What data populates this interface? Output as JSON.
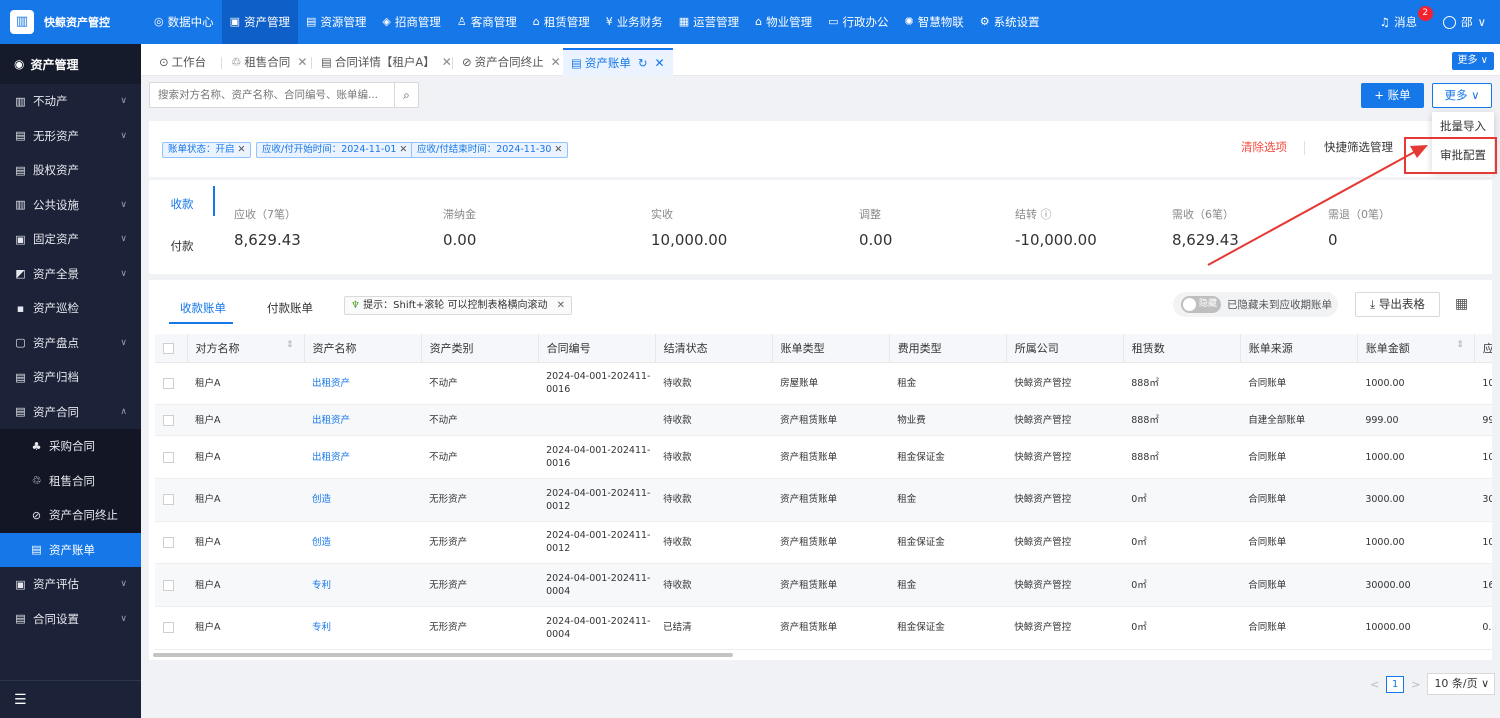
{
  "brand": "快鲸资产管控",
  "nav": [
    {
      "icon": "◎",
      "label": "数据中心"
    },
    {
      "icon": "▣",
      "label": "资产管理"
    },
    {
      "icon": "▤",
      "label": "资源管理"
    },
    {
      "icon": "◈",
      "label": "招商管理"
    },
    {
      "icon": "♙",
      "label": "客商管理"
    },
    {
      "icon": "⌂",
      "label": "租赁管理"
    },
    {
      "icon": "¥",
      "label": "业务财务"
    },
    {
      "icon": "▦",
      "label": "运营管理"
    },
    {
      "icon": "⌂",
      "label": "物业管理"
    },
    {
      "icon": "▭",
      "label": "行政办公"
    },
    {
      "icon": "✺",
      "label": "智慧物联"
    },
    {
      "icon": "⚙",
      "label": "系统设置"
    }
  ],
  "header": {
    "messages_label": "消息",
    "messages_count": "2",
    "user_name": "邵"
  },
  "sidebar": {
    "title": "资产管理",
    "items": [
      {
        "icon": "▥",
        "label": "不动产",
        "chevron": "∨"
      },
      {
        "icon": "▤",
        "label": "无形资产",
        "chevron": "∨"
      },
      {
        "icon": "▤",
        "label": "股权资产",
        "chevron": ""
      },
      {
        "icon": "▥",
        "label": "公共设施",
        "chevron": "∨"
      },
      {
        "icon": "▣",
        "label": "固定资产",
        "chevron": "∨"
      },
      {
        "icon": "◩",
        "label": "资产全景",
        "chevron": "∨"
      },
      {
        "icon": "▪",
        "label": "资产巡检",
        "chevron": ""
      },
      {
        "icon": "▢",
        "label": "资产盘点",
        "chevron": "∨"
      },
      {
        "icon": "▤",
        "label": "资产归档",
        "chevron": ""
      },
      {
        "icon": "▤",
        "label": "资产合同",
        "chevron": "∧"
      }
    ],
    "sub_items": [
      {
        "icon": "♣",
        "label": "采购合同"
      },
      {
        "icon": "♲",
        "label": "租售合同"
      },
      {
        "icon": "⊘",
        "label": "资产合同终止"
      },
      {
        "icon": "▤",
        "label": "资产账单"
      }
    ],
    "after_items": [
      {
        "icon": "▣",
        "label": "资产评估",
        "chevron": "∨"
      },
      {
        "icon": "▤",
        "label": "合同设置",
        "chevron": "∨"
      }
    ],
    "footer_icon": "☰"
  },
  "tabs": [
    {
      "icon": "⊙",
      "label": "工作台",
      "close": ""
    },
    {
      "icon": "♲",
      "label": "租售合同",
      "close": "✕"
    },
    {
      "icon": "▤",
      "label": "合同详情【租户A】",
      "close": "✕"
    },
    {
      "icon": "⊘",
      "label": "资产合同终止",
      "close": "✕"
    },
    {
      "icon": "▤",
      "label": "资产账单",
      "close": "✕"
    }
  ],
  "tabs_more": "更多 ∨",
  "search": {
    "placeholder": "搜索对方名称、资产名称、合同编号、账单编..."
  },
  "actions": {
    "add_label": "+ 账单",
    "more_label": "更多 ∨"
  },
  "dropdown": {
    "items": [
      "批量导入",
      "审批配置"
    ]
  },
  "filters": {
    "chips": [
      "账单状态：开启",
      "应收/付开始时间：2024-11-01",
      "应收/付结束时间：2024-11-30"
    ],
    "clear_label": "清除选项",
    "quick_label": "快捷筛选管理"
  },
  "stats": {
    "tabs": [
      "收款",
      "付款"
    ],
    "items": [
      {
        "label": "应收（7笔）",
        "value": "8,629.43"
      },
      {
        "label": "滞纳金",
        "value": "0.00"
      },
      {
        "label": "实收",
        "value": "10,000.00"
      },
      {
        "label": "调整",
        "value": "0.00"
      },
      {
        "label": "结转 ⓘ",
        "value": "-10,000.00"
      },
      {
        "label": "需收（6笔）",
        "value": "8,629.43"
      },
      {
        "label": "需退（0笔）",
        "value": "0"
      }
    ]
  },
  "table": {
    "subtabs": [
      "收款账单",
      "付款账单"
    ],
    "tip": "提示：Shift+滚轮 可以控制表格横向滚动",
    "tip_close": "✕",
    "toggle_label": "隐藏",
    "hide_label": "已隐藏未到应收期账单",
    "export_label": "导出表格",
    "columns": [
      "对方名称",
      "资产名称",
      "资产类别",
      "合同编号",
      "结清状态",
      "账单类型",
      "费用类型",
      "所属公司",
      "租赁数",
      "账单来源",
      "账单金额",
      "应"
    ],
    "rows": [
      [
        "租户A",
        "出租资产",
        "不动产",
        "2024-04-001-202411-0016",
        "待收款",
        "房屋账单",
        "租金",
        "快鲸资产管控",
        "888㎡",
        "合同账单",
        "1000.00",
        "10"
      ],
      [
        "租户A",
        "出租资产",
        "不动产",
        "",
        "待收款",
        "资产租赁账单",
        "物业费",
        "快鲸资产管控",
        "888㎡",
        "自建全部账单",
        "999.00",
        "99"
      ],
      [
        "租户A",
        "出租资产",
        "不动产",
        "2024-04-001-202411-0016",
        "待收款",
        "资产租赁账单",
        "租金保证金",
        "快鲸资产管控",
        "888㎡",
        "合同账单",
        "1000.00",
        "10"
      ],
      [
        "租户A",
        "创造",
        "无形资产",
        "2024-04-001-202411-0012",
        "待收款",
        "资产租赁账单",
        "租金",
        "快鲸资产管控",
        "0㎡",
        "合同账单",
        "3000.00",
        "30"
      ],
      [
        "租户A",
        "创造",
        "无形资产",
        "2024-04-001-202411-0012",
        "待收款",
        "资产租赁账单",
        "租金保证金",
        "快鲸资产管控",
        "0㎡",
        "合同账单",
        "1000.00",
        "10"
      ],
      [
        "租户A",
        "专利",
        "无形资产",
        "2024-04-001-202411-0004",
        "待收款",
        "资产租赁账单",
        "租金",
        "快鲸资产管控",
        "0㎡",
        "合同账单",
        "30000.00",
        "16"
      ],
      [
        "租户A",
        "专利",
        "无形资产",
        "2024-04-001-202411-0004",
        "已结清",
        "资产租赁账单",
        "租金保证金",
        "快鲸资产管控",
        "0㎡",
        "合同账单",
        "10000.00",
        "0."
      ]
    ]
  },
  "pagination": {
    "page": "1",
    "page_size": "10 条/页 ∨",
    "prev": "<",
    "next": ">"
  },
  "colors": {
    "primary": "#1677e8",
    "sidebar": "#1c2237",
    "danger": "#f5483b",
    "highlight": "#e53935"
  }
}
